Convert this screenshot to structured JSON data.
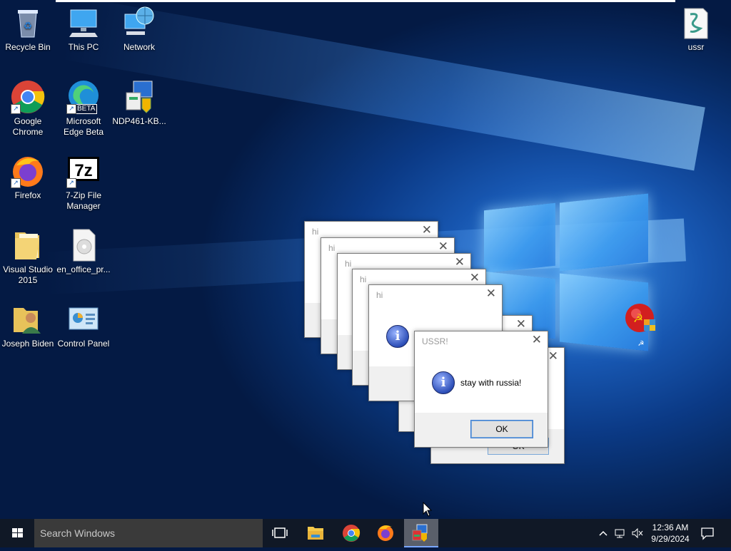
{
  "desktop": {
    "icons": [
      {
        "label": "Recycle Bin"
      },
      {
        "label": "This PC"
      },
      {
        "label": "Network"
      },
      {
        "label": "Google Chrome"
      },
      {
        "label": "Microsoft Edge Beta"
      },
      {
        "label": "NDP461-KB..."
      },
      {
        "label": "Firefox"
      },
      {
        "label": "7-Zip File Manager"
      },
      {
        "label": "Visual Studio 2015"
      },
      {
        "label": "en_office_pr..."
      },
      {
        "label": "Joseph Biden"
      },
      {
        "label": "Control Panel"
      },
      {
        "label": "ussr"
      }
    ],
    "edge_badge": "BETA",
    "zip_glyph": "7z"
  },
  "dialogs": {
    "hi_title": "hi",
    "main": {
      "title": "USSR!",
      "message": "stay with russia!",
      "ok_label": "OK"
    },
    "close_glyph": "✕",
    "info_glyph": "i"
  },
  "taskbar": {
    "search_placeholder": "Search Windows",
    "time": "12:36 AM",
    "date": "9/29/2024"
  },
  "colors": {
    "accent": "#3c7fd6",
    "taskbar": "#101826"
  }
}
